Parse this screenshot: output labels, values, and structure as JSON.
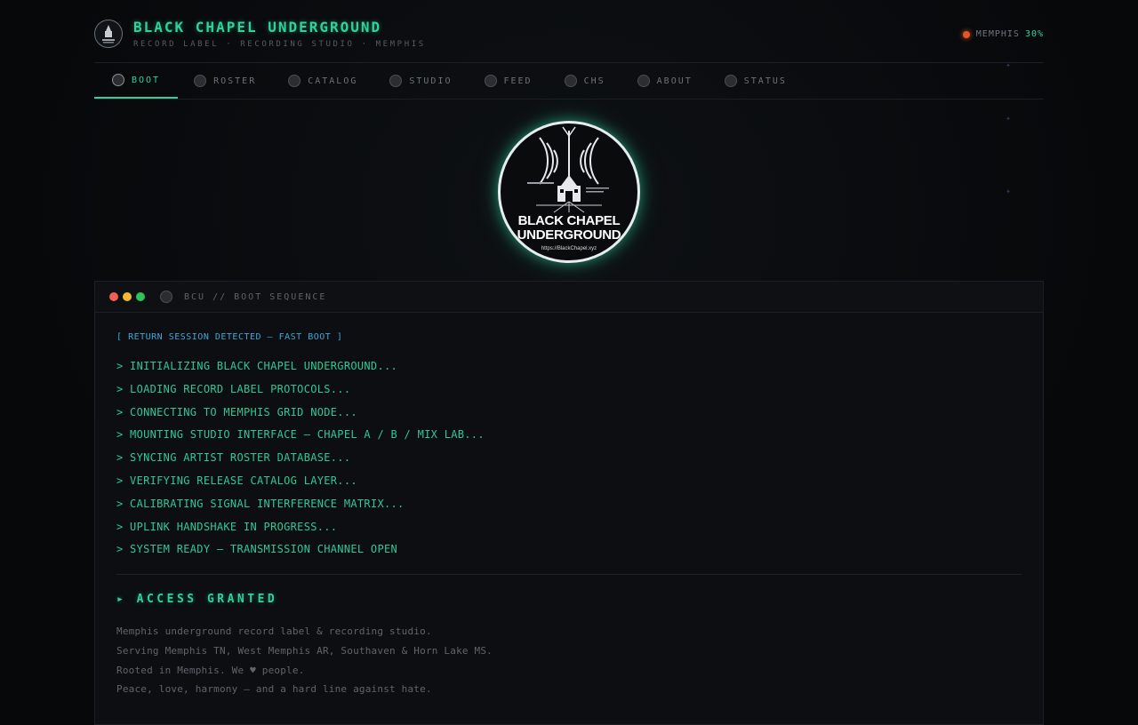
{
  "header": {
    "title": "BLACK CHAPEL UNDERGROUND",
    "subtitle": "RECORD LABEL · RECORDING STUDIO · MEMPHIS",
    "region_label": "MEMPHIS",
    "region_value": "30%",
    "status_color": "#e0562a"
  },
  "nav": {
    "tabs": [
      {
        "label": "BOOT",
        "active": true
      },
      {
        "label": "ROSTER"
      },
      {
        "label": "CATALOG"
      },
      {
        "label": "STUDIO"
      },
      {
        "label": "FEED"
      },
      {
        "label": "CHS"
      },
      {
        "label": "ABOUT"
      },
      {
        "label": "STATUS"
      }
    ]
  },
  "emblem": {
    "line1": "BLACK CHAPEL",
    "line2": "UNDERGROUND",
    "url": "https://BlackChapel.xyz"
  },
  "terminal": {
    "title": "BCU // BOOT SEQUENCE",
    "session_open": "[",
    "session_text": "RETURN SESSION DETECTED — FAST BOOT",
    "session_close": "]",
    "lines": [
      "> INITIALIZING BLACK CHAPEL UNDERGROUND...",
      "> LOADING RECORD LABEL PROTOCOLS...",
      "> CONNECTING TO MEMPHIS GRID NODE...",
      "> MOUNTING STUDIO INTERFACE — CHAPEL A / B / MIX LAB...",
      "> SYNCING ARTIST ROSTER DATABASE...",
      "> VERIFYING RELEASE CATALOG LAYER...",
      "> CALIBRATING SIGNAL INTERFERENCE MATRIX...",
      "> UPLINK HANDSHAKE IN PROGRESS...",
      "> SYSTEM READY — TRANSMISSION CHANNEL OPEN"
    ],
    "granted": "▸ ACCESS GRANTED",
    "about": [
      "Memphis underground record label & recording studio.",
      "Serving Memphis TN, West Memphis AR, Southaven & Horn Lake MS.",
      "Rooted in Memphis. We ♥ people.",
      "Peace, love, harmony — and a hard line against hate."
    ]
  },
  "colors": {
    "accent": "#2fd39a",
    "info": "#3da7d8",
    "background": "#08090b"
  }
}
